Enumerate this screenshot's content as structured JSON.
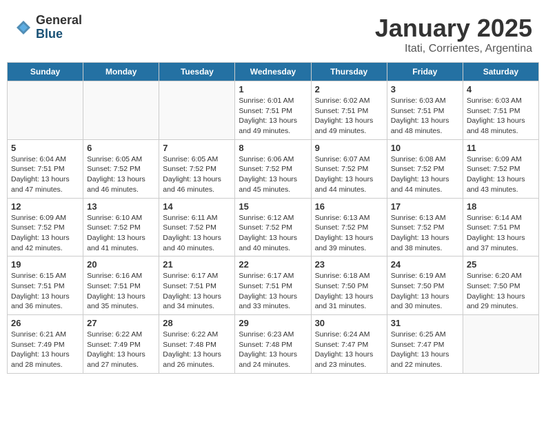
{
  "header": {
    "logo_general": "General",
    "logo_blue": "Blue",
    "month_title": "January 2025",
    "location": "Itati, Corrientes, Argentina"
  },
  "days_of_week": [
    "Sunday",
    "Monday",
    "Tuesday",
    "Wednesday",
    "Thursday",
    "Friday",
    "Saturday"
  ],
  "weeks": [
    [
      {
        "day": "",
        "info": ""
      },
      {
        "day": "",
        "info": ""
      },
      {
        "day": "",
        "info": ""
      },
      {
        "day": "1",
        "info": "Sunrise: 6:01 AM\nSunset: 7:51 PM\nDaylight: 13 hours\nand 49 minutes."
      },
      {
        "day": "2",
        "info": "Sunrise: 6:02 AM\nSunset: 7:51 PM\nDaylight: 13 hours\nand 49 minutes."
      },
      {
        "day": "3",
        "info": "Sunrise: 6:03 AM\nSunset: 7:51 PM\nDaylight: 13 hours\nand 48 minutes."
      },
      {
        "day": "4",
        "info": "Sunrise: 6:03 AM\nSunset: 7:51 PM\nDaylight: 13 hours\nand 48 minutes."
      }
    ],
    [
      {
        "day": "5",
        "info": "Sunrise: 6:04 AM\nSunset: 7:51 PM\nDaylight: 13 hours\nand 47 minutes."
      },
      {
        "day": "6",
        "info": "Sunrise: 6:05 AM\nSunset: 7:52 PM\nDaylight: 13 hours\nand 46 minutes."
      },
      {
        "day": "7",
        "info": "Sunrise: 6:05 AM\nSunset: 7:52 PM\nDaylight: 13 hours\nand 46 minutes."
      },
      {
        "day": "8",
        "info": "Sunrise: 6:06 AM\nSunset: 7:52 PM\nDaylight: 13 hours\nand 45 minutes."
      },
      {
        "day": "9",
        "info": "Sunrise: 6:07 AM\nSunset: 7:52 PM\nDaylight: 13 hours\nand 44 minutes."
      },
      {
        "day": "10",
        "info": "Sunrise: 6:08 AM\nSunset: 7:52 PM\nDaylight: 13 hours\nand 44 minutes."
      },
      {
        "day": "11",
        "info": "Sunrise: 6:09 AM\nSunset: 7:52 PM\nDaylight: 13 hours\nand 43 minutes."
      }
    ],
    [
      {
        "day": "12",
        "info": "Sunrise: 6:09 AM\nSunset: 7:52 PM\nDaylight: 13 hours\nand 42 minutes."
      },
      {
        "day": "13",
        "info": "Sunrise: 6:10 AM\nSunset: 7:52 PM\nDaylight: 13 hours\nand 41 minutes."
      },
      {
        "day": "14",
        "info": "Sunrise: 6:11 AM\nSunset: 7:52 PM\nDaylight: 13 hours\nand 40 minutes."
      },
      {
        "day": "15",
        "info": "Sunrise: 6:12 AM\nSunset: 7:52 PM\nDaylight: 13 hours\nand 40 minutes."
      },
      {
        "day": "16",
        "info": "Sunrise: 6:13 AM\nSunset: 7:52 PM\nDaylight: 13 hours\nand 39 minutes."
      },
      {
        "day": "17",
        "info": "Sunrise: 6:13 AM\nSunset: 7:52 PM\nDaylight: 13 hours\nand 38 minutes."
      },
      {
        "day": "18",
        "info": "Sunrise: 6:14 AM\nSunset: 7:51 PM\nDaylight: 13 hours\nand 37 minutes."
      }
    ],
    [
      {
        "day": "19",
        "info": "Sunrise: 6:15 AM\nSunset: 7:51 PM\nDaylight: 13 hours\nand 36 minutes."
      },
      {
        "day": "20",
        "info": "Sunrise: 6:16 AM\nSunset: 7:51 PM\nDaylight: 13 hours\nand 35 minutes."
      },
      {
        "day": "21",
        "info": "Sunrise: 6:17 AM\nSunset: 7:51 PM\nDaylight: 13 hours\nand 34 minutes."
      },
      {
        "day": "22",
        "info": "Sunrise: 6:17 AM\nSunset: 7:51 PM\nDaylight: 13 hours\nand 33 minutes."
      },
      {
        "day": "23",
        "info": "Sunrise: 6:18 AM\nSunset: 7:50 PM\nDaylight: 13 hours\nand 31 minutes."
      },
      {
        "day": "24",
        "info": "Sunrise: 6:19 AM\nSunset: 7:50 PM\nDaylight: 13 hours\nand 30 minutes."
      },
      {
        "day": "25",
        "info": "Sunrise: 6:20 AM\nSunset: 7:50 PM\nDaylight: 13 hours\nand 29 minutes."
      }
    ],
    [
      {
        "day": "26",
        "info": "Sunrise: 6:21 AM\nSunset: 7:49 PM\nDaylight: 13 hours\nand 28 minutes."
      },
      {
        "day": "27",
        "info": "Sunrise: 6:22 AM\nSunset: 7:49 PM\nDaylight: 13 hours\nand 27 minutes."
      },
      {
        "day": "28",
        "info": "Sunrise: 6:22 AM\nSunset: 7:48 PM\nDaylight: 13 hours\nand 26 minutes."
      },
      {
        "day": "29",
        "info": "Sunrise: 6:23 AM\nSunset: 7:48 PM\nDaylight: 13 hours\nand 24 minutes."
      },
      {
        "day": "30",
        "info": "Sunrise: 6:24 AM\nSunset: 7:47 PM\nDaylight: 13 hours\nand 23 minutes."
      },
      {
        "day": "31",
        "info": "Sunrise: 6:25 AM\nSunset: 7:47 PM\nDaylight: 13 hours\nand 22 minutes."
      },
      {
        "day": "",
        "info": ""
      }
    ]
  ]
}
